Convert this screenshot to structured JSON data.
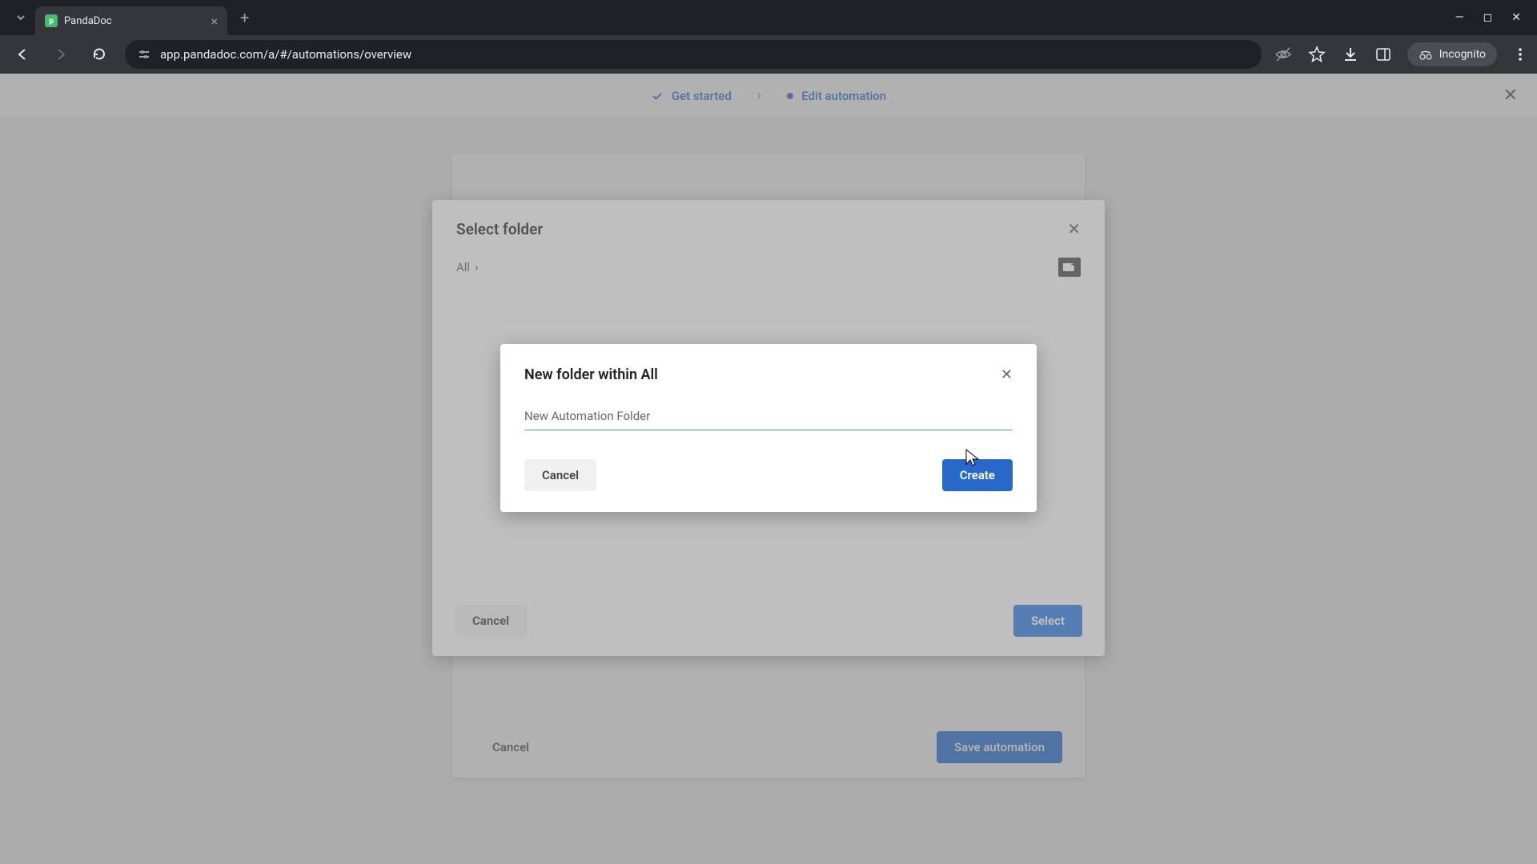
{
  "browser": {
    "tab_title": "PandaDoc",
    "url": "app.pandadoc.com/a/#/automations/overview",
    "incognito_label": "Incognito"
  },
  "header": {
    "step1_label": "Get started",
    "step2_label": "Edit automation"
  },
  "automation": {
    "cancel_label": "Cancel",
    "save_label": "Save automation"
  },
  "select_folder": {
    "title": "Select folder",
    "breadcrumb_root": "All",
    "cancel_label": "Cancel",
    "select_label": "Select"
  },
  "new_folder": {
    "title": "New folder within All",
    "input_value": "New Automation Folder",
    "cancel_label": "Cancel",
    "create_label": "Create"
  }
}
